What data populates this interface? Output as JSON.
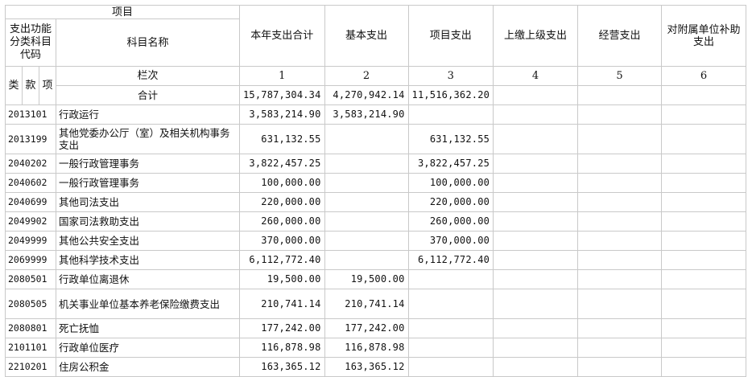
{
  "header": {
    "item": "项目",
    "func_code": "支出功能分类科目代码",
    "subject_name": "科目名称",
    "col_index": "栏次",
    "lei": "类",
    "kuan": "款",
    "xiang": "项",
    "total_label": "合计",
    "columns": [
      "本年支出合计",
      "基本支出",
      "项目支出",
      "上缴上级支出",
      "经营支出",
      "对附属单位补助支出"
    ],
    "column_numbers": [
      "1",
      "2",
      "3",
      "4",
      "5",
      "6"
    ]
  },
  "total": {
    "total": "15,787,304.34",
    "basic": "4,270,942.14",
    "project": "11,516,362.20"
  },
  "rows": [
    {
      "code": "2013101",
      "name": "行政运行",
      "total": "3,583,214.90",
      "basic": "3,583,214.90",
      "project": ""
    },
    {
      "code": "2013199",
      "name": "其他党委办公厅（室）及相关机构事务支出",
      "total": "631,132.55",
      "basic": "",
      "project": "631,132.55"
    },
    {
      "code": "2040202",
      "name": "一般行政管理事务",
      "total": "3,822,457.25",
      "basic": "",
      "project": "3,822,457.25"
    },
    {
      "code": "2040602",
      "name": "一般行政管理事务",
      "total": "100,000.00",
      "basic": "",
      "project": "100,000.00"
    },
    {
      "code": "2040699",
      "name": "其他司法支出",
      "total": "220,000.00",
      "basic": "",
      "project": "220,000.00"
    },
    {
      "code": "2049902",
      "name": "国家司法救助支出",
      "total": "260,000.00",
      "basic": "",
      "project": "260,000.00"
    },
    {
      "code": "2049999",
      "name": "其他公共安全支出",
      "total": "370,000.00",
      "basic": "",
      "project": "370,000.00"
    },
    {
      "code": "2069999",
      "name": "其他科学技术支出",
      "total": "6,112,772.40",
      "basic": "",
      "project": "6,112,772.40"
    },
    {
      "code": "2080501",
      "name": "行政单位离退休",
      "total": "19,500.00",
      "basic": "19,500.00",
      "project": ""
    },
    {
      "code": "2080505",
      "name": "机关事业单位基本养老保险缴费支出",
      "total": "210,741.14",
      "basic": "210,741.14",
      "project": ""
    },
    {
      "code": "2080801",
      "name": "死亡抚恤",
      "total": "177,242.00",
      "basic": "177,242.00",
      "project": ""
    },
    {
      "code": "2101101",
      "name": "行政单位医疗",
      "total": "116,878.98",
      "basic": "116,878.98",
      "project": ""
    },
    {
      "code": "2210201",
      "name": "住房公积金",
      "total": "163,365.12",
      "basic": "163,365.12",
      "project": ""
    }
  ]
}
